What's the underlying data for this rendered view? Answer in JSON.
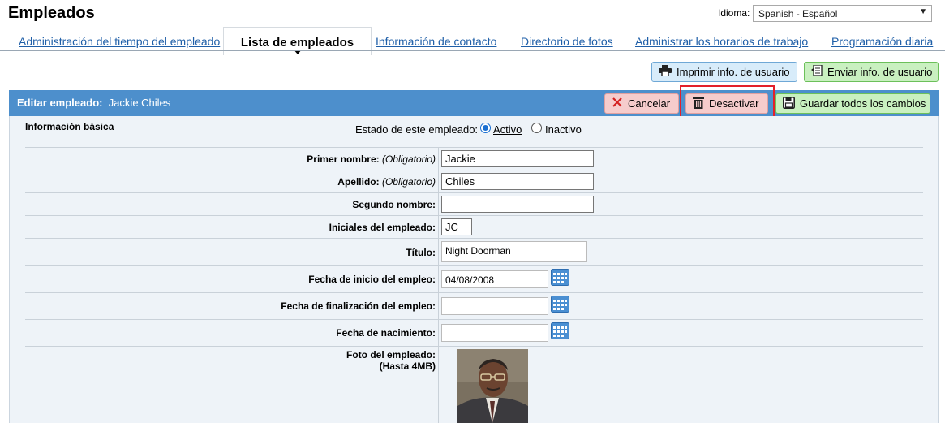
{
  "header": {
    "title": "Empleados",
    "language_label": "Idioma:",
    "language_value": "Spanish - Español"
  },
  "tabs": [
    {
      "label": "Administración del tiempo del empleado"
    },
    {
      "label": "Lista de empleados"
    },
    {
      "label": "Información de contacto"
    },
    {
      "label": "Directorio de fotos"
    },
    {
      "label": "Administrar los horarios de trabajo"
    },
    {
      "label": "Programación diaria"
    }
  ],
  "actions": {
    "print_label": "Imprimir info. de usuario",
    "send_label": "Enviar info. de usuario"
  },
  "editbar": {
    "prefix": "Editar empleado:",
    "employee_name": "Jackie Chiles",
    "cancel_label": "Cancelar",
    "deactivate_label": "Desactivar",
    "save_label": "Guardar todos los cambios"
  },
  "form": {
    "section_label": "Información básica",
    "status_label": "Estado de este empleado:",
    "status_active": "Activo",
    "status_inactive": "Inactivo",
    "required_note": "(Obligatorio)",
    "first_name_label": "Primer nombre:",
    "first_name_value": "Jackie",
    "last_name_label": "Apellido:",
    "last_name_value": "Chiles",
    "middle_name_label": "Segundo nombre:",
    "middle_name_value": "",
    "initials_label": "Iniciales del empleado:",
    "initials_value": "JC",
    "title_label": "Título:",
    "title_value": "Night Doorman",
    "start_date_label": "Fecha de inicio del empleo:",
    "start_date_value": "04/08/2008",
    "end_date_label": "Fecha de finalización del empleo:",
    "end_date_value": "",
    "birth_date_label": "Fecha de nacimiento:",
    "birth_date_value": "",
    "photo_label": "Foto del empleado:",
    "photo_limit": "(Hasta 4MB)"
  },
  "colors": {
    "accent": "#4d8fcc",
    "link": "#1f5fa8",
    "highlight": "#e3202a",
    "panel": "#eef3f8"
  }
}
